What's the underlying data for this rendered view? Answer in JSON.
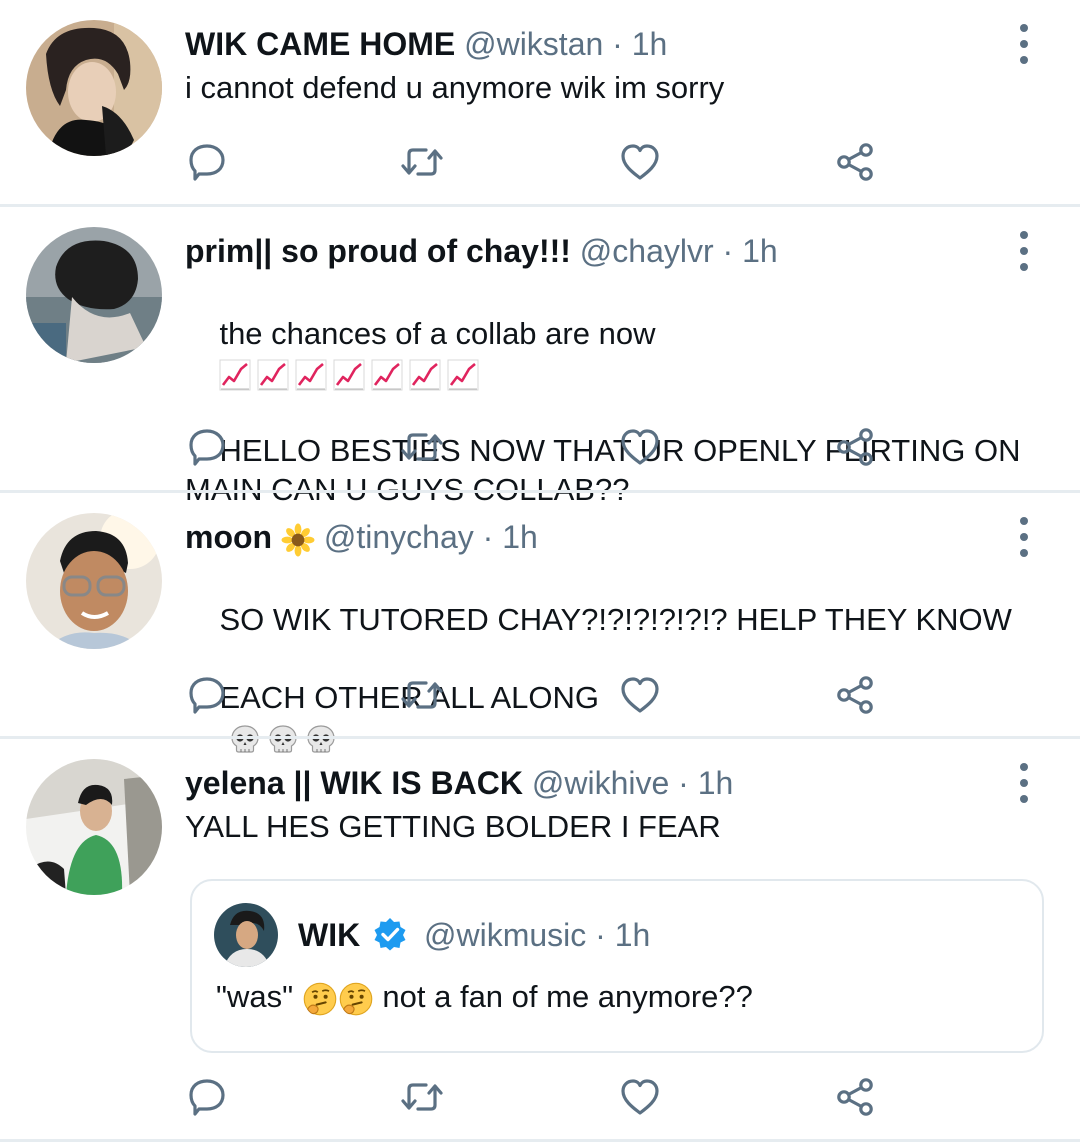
{
  "tweets": [
    {
      "name": "WIK CAME HOME",
      "handle": "@wikstan",
      "dot": "·",
      "time": "1h",
      "text": "i cannot defend u anymore wik im sorry"
    },
    {
      "name": "prim|| so proud of chay!!!",
      "handle": "@chaylvr",
      "dot": "·",
      "time": "1h",
      "text_line1": "the chances of a collab are now",
      "text_rest": "HELLO BESTIES NOW THAT UR OPENLY FLIRTING ON MAIN CAN U GUYS COLLAB??",
      "emoji_icon": "chart-increasing-icon",
      "emoji_count": 7
    },
    {
      "name": "moon",
      "name_emoji": "sunflower-icon",
      "handle": "@tinychay",
      "dot": "·",
      "time": "1h",
      "text_line1": "SO WIK TUTORED CHAY?!?!?!?!?!? HELP THEY KNOW",
      "text_line2": "EACH OTHER ALL ALONG",
      "emoji_icon": "skull-icon",
      "emoji_count": 3
    },
    {
      "name": "yelena || WIK IS BACK",
      "handle": "@wikhive",
      "dot": "·",
      "time": "1h",
      "text": "YALL HES GETTING BOLDER I FEAR",
      "quote": {
        "name": "WIK",
        "verified_icon": "verified-badge-icon",
        "handle": "@wikmusic",
        "dot": "·",
        "time": "1h",
        "text_before": "\"was\"",
        "emoji_icon": "thinking-face-icon",
        "text_after": "not a fan of me anymore??"
      }
    }
  ],
  "actions": [
    "reply-icon",
    "retweet-icon",
    "like-icon",
    "share-icon"
  ],
  "colors": {
    "text": "#0f1419",
    "secondary": "#5b7083",
    "divider": "#e6ecf0",
    "verified": "#1d9bf0",
    "chart_red": "#e0245e"
  }
}
